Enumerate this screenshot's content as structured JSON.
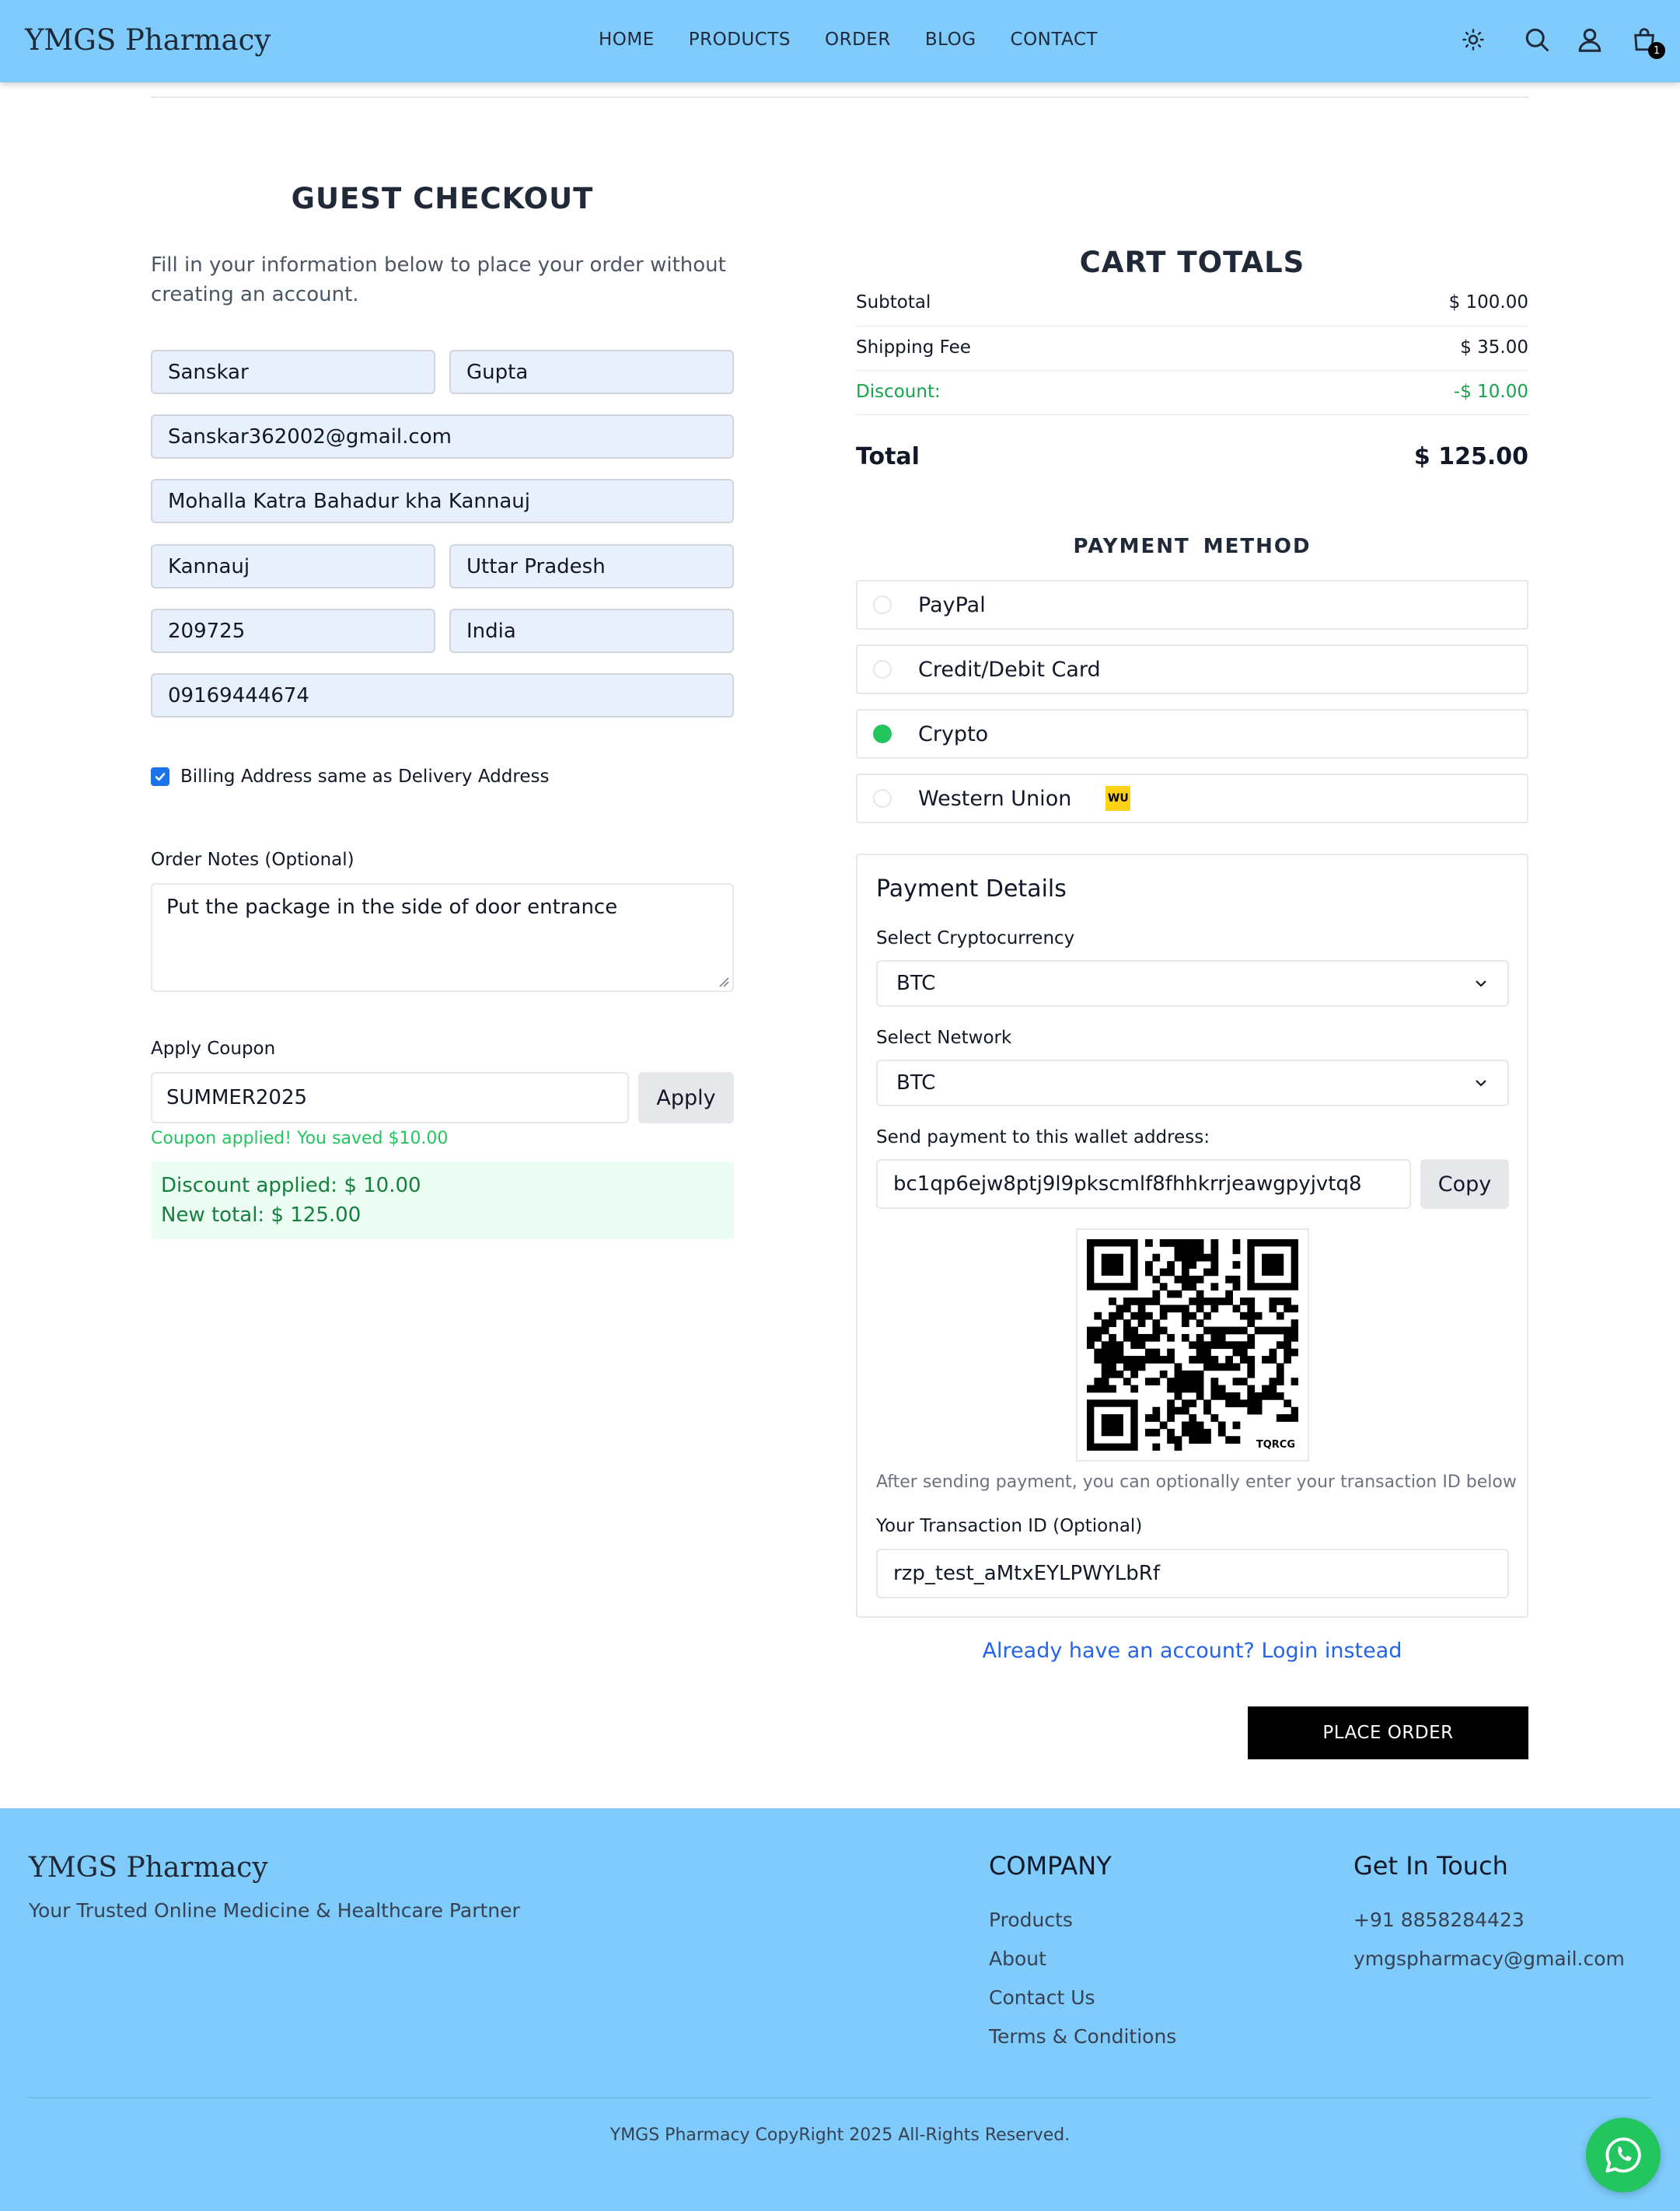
{
  "header": {
    "logo": "YMGS Pharmacy",
    "nav": [
      "HOME",
      "PRODUCTS",
      "ORDER",
      "BLOG",
      "CONTACT"
    ],
    "cart_count": "1"
  },
  "checkout": {
    "title": "GUEST CHECKOUT",
    "intro": "Fill in your information below to place your order without creating an account.",
    "first_name": "Sanskar",
    "last_name": "Gupta",
    "email": "Sanskar362002@gmail.com",
    "street": "Mohalla Katra Bahadur kha Kannauj",
    "city": "Kannauj",
    "state": "Uttar Pradesh",
    "zipcode": "209725",
    "country": "India",
    "phone": "09169444674",
    "billing_same_label": "Billing Address same as Delivery Address",
    "notes_label": "Order Notes (Optional)",
    "notes_value": "Put the package in the side of door entrance",
    "coupon_label": "Apply Coupon",
    "coupon_value": "SUMMER2025",
    "apply_label": "Apply",
    "coupon_msg": "Coupon applied! You saved $10.00",
    "discount_line": "Discount applied: $ 10.00",
    "new_total_line": "New total: $ 125.00"
  },
  "cart_totals": {
    "title": "CART TOTALS",
    "subtotal_label": "Subtotal",
    "subtotal_value": "$ 100.00",
    "shipping_label": "Shipping Fee",
    "shipping_value": "$ 35.00",
    "discount_label": "Discount:",
    "discount_value": "-$ 10.00",
    "total_label": "Total",
    "total_value": "$ 125.00"
  },
  "payment": {
    "title": "PAYMENT METHOD",
    "options": [
      "PayPal",
      "Credit/Debit Card",
      "Crypto",
      "Western Union"
    ],
    "selected": "Crypto",
    "details_title": "Payment Details",
    "crypto_label": "Select Cryptocurrency",
    "crypto_value": "BTC",
    "network_label": "Select Network",
    "network_value": "BTC",
    "wallet_label": "Send payment to this wallet address:",
    "wallet_value": "bc1qp6ejw8ptj9l9pkscmlf8fhhkrrjeawgpyjvtq8",
    "copy_label": "Copy",
    "qr_brand": "TQRCG",
    "after_note": "After sending payment, you can optionally enter your transaction ID below",
    "txn_label": "Your Transaction ID (Optional)",
    "txn_value": "rzp_test_aMtxEYLPWYLbRf"
  },
  "login_link": "Already have an account? Login instead",
  "place_order": "PLACE ORDER",
  "footer": {
    "logo": "YMGS Pharmacy",
    "tagline": "Your Trusted Online Medicine & Healthcare Partner",
    "company_title": "COMPANY",
    "company_links": [
      "Products",
      "About",
      "Contact Us",
      "Terms & Conditions"
    ],
    "contact_title": "Get In Touch",
    "phone": "+91 8858284423",
    "email": "ymgspharmacy@gmail.com",
    "copyright": "YMGS Pharmacy CopyRight 2025 All-Rights Reserved."
  },
  "colors": {
    "header_bg": "#7ecbfc",
    "accent_green": "#22c55e",
    "link_blue": "#2563eb",
    "input_autofill": "#e8f0fe"
  }
}
